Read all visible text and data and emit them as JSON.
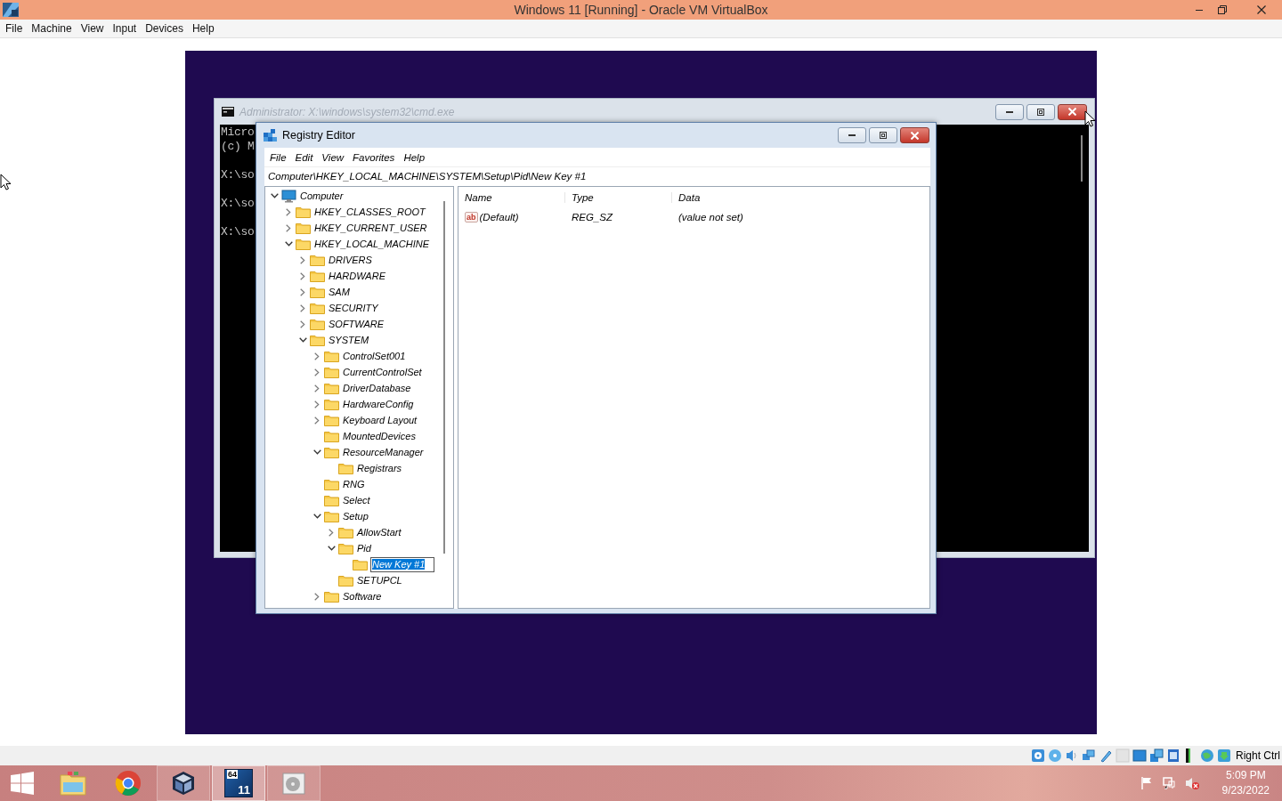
{
  "window": {
    "title": "Windows 11 [Running] - Oracle VM VirtualBox"
  },
  "menu": [
    "File",
    "Machine",
    "View",
    "Input",
    "Devices",
    "Help"
  ],
  "cmd": {
    "title": "Administrator: X:\\windows\\system32\\cmd.exe",
    "active": false,
    "paragraphs": [
      [
        "Micro",
        "(c) M"
      ],
      [
        "X:\\so"
      ],
      [
        "X:\\so"
      ],
      [
        "X:\\so"
      ]
    ]
  },
  "regedit": {
    "title": "Registry Editor",
    "active": true,
    "menu": [
      "File",
      "Edit",
      "View",
      "Favorites",
      "Help"
    ],
    "address": "Computer\\HKEY_LOCAL_MACHINE\\SYSTEM\\Setup\\Pid\\New Key #1",
    "tree": [
      {
        "label": "Computer",
        "kind": "computer",
        "expandable": true,
        "expanded": true,
        "selected": false,
        "children": [
          {
            "label": "HKEY_CLASSES_ROOT",
            "kind": "folder",
            "expandable": true,
            "expanded": false,
            "selected": false
          },
          {
            "label": "HKEY_CURRENT_USER",
            "kind": "folder",
            "expandable": true,
            "expanded": false,
            "selected": false
          },
          {
            "label": "HKEY_LOCAL_MACHINE",
            "kind": "folder",
            "expandable": true,
            "expanded": true,
            "selected": false,
            "children": [
              {
                "label": "DRIVERS",
                "kind": "folder",
                "expandable": true,
                "expanded": false,
                "selected": false
              },
              {
                "label": "HARDWARE",
                "kind": "folder",
                "expandable": true,
                "expanded": false,
                "selected": false
              },
              {
                "label": "SAM",
                "kind": "folder",
                "expandable": true,
                "expanded": false,
                "selected": false
              },
              {
                "label": "SECURITY",
                "kind": "folder",
                "expandable": true,
                "expanded": false,
                "selected": false
              },
              {
                "label": "SOFTWARE",
                "kind": "folder",
                "expandable": true,
                "expanded": false,
                "selected": false
              },
              {
                "label": "SYSTEM",
                "kind": "folder",
                "expandable": true,
                "expanded": true,
                "selected": false,
                "children": [
                  {
                    "label": "ControlSet001",
                    "kind": "folder",
                    "expandable": true,
                    "expanded": false,
                    "selected": false
                  },
                  {
                    "label": "CurrentControlSet",
                    "kind": "folder",
                    "expandable": true,
                    "expanded": false,
                    "selected": false
                  },
                  {
                    "label": "DriverDatabase",
                    "kind": "folder",
                    "expandable": true,
                    "expanded": false,
                    "selected": false
                  },
                  {
                    "label": "HardwareConfig",
                    "kind": "folder",
                    "expandable": true,
                    "expanded": false,
                    "selected": false
                  },
                  {
                    "label": "Keyboard Layout",
                    "kind": "folder",
                    "expandable": true,
                    "expanded": false,
                    "selected": false
                  },
                  {
                    "label": "MountedDevices",
                    "kind": "folder",
                    "expandable": false,
                    "selected": false
                  },
                  {
                    "label": "ResourceManager",
                    "kind": "folder",
                    "expandable": true,
                    "expanded": true,
                    "selected": false,
                    "children": [
                      {
                        "label": "Registrars",
                        "kind": "folder",
                        "expandable": false,
                        "selected": false
                      }
                    ]
                  },
                  {
                    "label": "RNG",
                    "kind": "folder",
                    "expandable": false,
                    "selected": false
                  },
                  {
                    "label": "Select",
                    "kind": "folder",
                    "expandable": false,
                    "selected": false
                  },
                  {
                    "label": "Setup",
                    "kind": "folder",
                    "expandable": true,
                    "expanded": true,
                    "selected": false,
                    "children": [
                      {
                        "label": "AllowStart",
                        "kind": "folder",
                        "expandable": true,
                        "expanded": false,
                        "selected": false
                      },
                      {
                        "label": "Pid",
                        "kind": "folder",
                        "expandable": true,
                        "expanded": true,
                        "selected": false,
                        "children": [
                          {
                            "label": "New Key #1",
                            "kind": "folder",
                            "expandable": false,
                            "selected": true,
                            "editing": true
                          }
                        ]
                      },
                      {
                        "label": "SETUPCL",
                        "kind": "folder",
                        "expandable": false,
                        "selected": false
                      }
                    ]
                  },
                  {
                    "label": "Software",
                    "kind": "folder",
                    "expandable": true,
                    "expanded": false,
                    "selected": false
                  }
                ]
              }
            ]
          }
        ]
      }
    ],
    "columns": [
      "Name",
      "Type",
      "Data"
    ],
    "values": [
      {
        "type_icon": "ab",
        "name": "(Default)",
        "type": "REG_SZ",
        "data": "(value not set)"
      }
    ]
  },
  "status_bar": {
    "host_key": "Right Ctrl"
  },
  "taskbar": {
    "items": [
      {
        "kind": "start",
        "running": false,
        "selected": false
      },
      {
        "kind": "explorer",
        "running": false,
        "selected": false
      },
      {
        "kind": "browser",
        "running": false,
        "selected": false
      },
      {
        "kind": "virtualbox",
        "running": true,
        "selected": false
      },
      {
        "kind": "vm",
        "running": true,
        "selected": true,
        "badges": [
          "64",
          "11"
        ]
      },
      {
        "kind": "disc",
        "running": true,
        "selected": false
      }
    ],
    "clock": {
      "time": "5:09 PM",
      "date": "9/23/2022"
    }
  }
}
